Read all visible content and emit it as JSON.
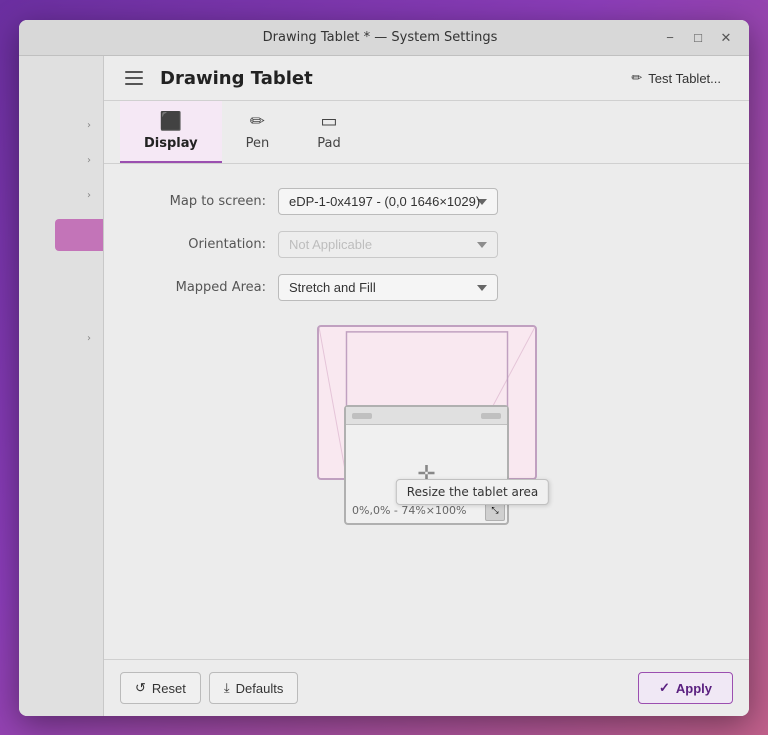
{
  "window": {
    "title": "Drawing Tablet * — System Settings",
    "minimize_label": "−",
    "maximize_label": "□",
    "close_label": "✕"
  },
  "header": {
    "title": "Drawing Tablet",
    "test_tablet_label": "Test Tablet..."
  },
  "tabs": [
    {
      "id": "display",
      "label": "Display",
      "icon": "⬜",
      "active": true
    },
    {
      "id": "pen",
      "label": "Pen",
      "icon": "✏"
    },
    {
      "id": "pad",
      "label": "Pad",
      "icon": "⬜"
    }
  ],
  "settings": {
    "map_to_screen_label": "Map to screen:",
    "map_to_screen_value": "eDP-1-0x4197 - (0,0 1646×1029)",
    "orientation_label": "Orientation:",
    "orientation_value": "Not Applicable",
    "mapped_area_label": "Mapped Area:",
    "mapped_area_value": "Stretch and Fill"
  },
  "preview": {
    "coords_label": "0%,0% - 74%×100%",
    "tooltip": "Resize the tablet area"
  },
  "footer": {
    "reset_label": "Reset",
    "defaults_label": "Defaults",
    "apply_label": "Apply"
  },
  "sidebar": {
    "items": [
      "",
      "",
      "",
      ""
    ]
  }
}
